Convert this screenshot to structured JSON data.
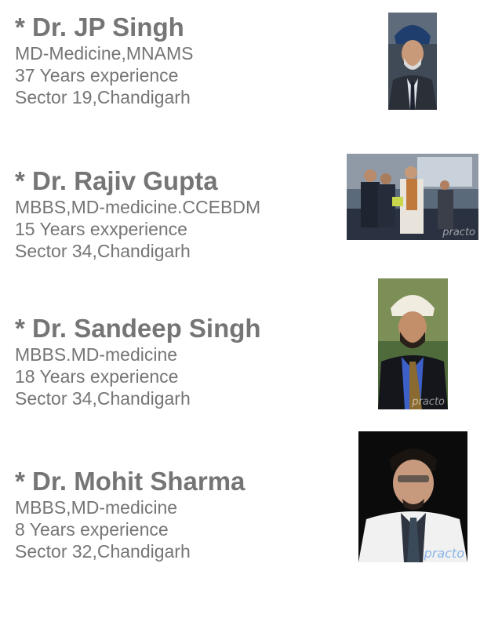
{
  "doctors": [
    {
      "name": "* Dr. JP Singh",
      "qualification": "MD-Medicine,MNAMS",
      "experience": "37 Years experience",
      "location": "Sector 19,Chandigarh",
      "photo_alt": "Photo of Dr. JP Singh"
    },
    {
      "name": "* Dr. Rajiv Gupta",
      "qualification": "MBBS,MD-medicine.CCEBDM",
      "experience": "15 Years exxperience",
      "location": "Sector 34,Chandigarh",
      "photo_alt": "Photo of Dr. Rajiv Gupta"
    },
    {
      "name": "* Dr. Sandeep Singh",
      "qualification": "MBBS.MD-medicine",
      "experience": "18 Years experience",
      "location": "Sector 34,Chandigarh",
      "photo_alt": "Photo of Dr. Sandeep Singh"
    },
    {
      "name": "* Dr. Mohit Sharma",
      "qualification": "MBBS,MD-medicine",
      "experience": "8 Years experience",
      "location": "Sector 32,Chandigarh",
      "photo_alt": "Photo of Dr. Mohit Sharma"
    }
  ],
  "colors": {
    "text": "#757575",
    "background": "#ffffff"
  }
}
